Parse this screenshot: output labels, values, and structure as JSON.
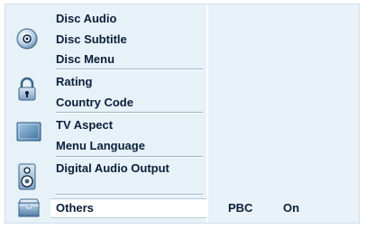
{
  "menu": {
    "groups": [
      {
        "icon": "disc-icon",
        "items": [
          "Disc Audio",
          "Disc Subtitle",
          "Disc Menu"
        ]
      },
      {
        "icon": "padlock-icon",
        "items": [
          "Rating",
          "Country Code"
        ]
      },
      {
        "icon": "tv-screen-icon",
        "items": [
          "TV Aspect",
          "Menu Language"
        ]
      },
      {
        "icon": "speaker-icon",
        "items": [
          "Digital Audio Output"
        ]
      },
      {
        "icon": "others-tray-icon",
        "items": [
          "Others"
        ]
      }
    ],
    "selected": "Others"
  },
  "detail": {
    "setting_name": "PBC",
    "setting_value": "On"
  },
  "colors": {
    "panel_background": "#e7f1f8",
    "text": "#0b1f3a",
    "selection": "#ffffff"
  }
}
